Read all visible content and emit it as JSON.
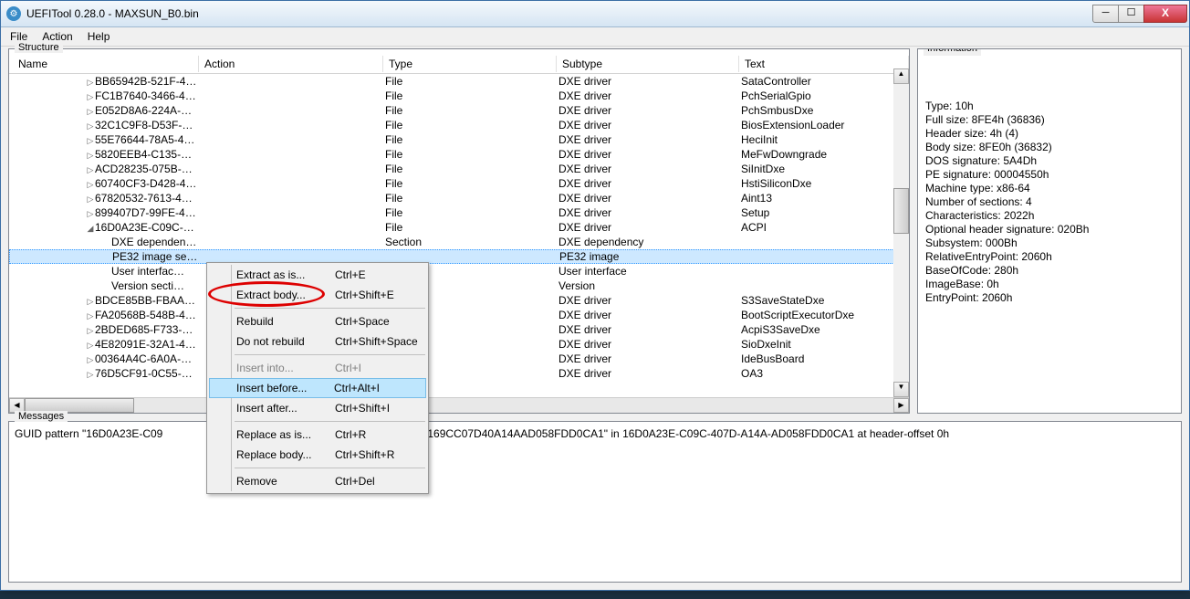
{
  "title": "UEFITool 0.28.0 - MAXSUN_B0.bin",
  "menu": {
    "file": "File",
    "action": "Action",
    "help": "Help"
  },
  "panels": {
    "structure": "Structure",
    "information": "Information",
    "messages": "Messages"
  },
  "headers": {
    "name": "Name",
    "action": "Action",
    "type": "Type",
    "subtype": "Subtype",
    "text": "Text"
  },
  "rows": [
    {
      "indent": 84,
      "tri": "▷",
      "name": "BB65942B-521F-4…",
      "type": "File",
      "subtype": "DXE driver",
      "text": "SataController"
    },
    {
      "indent": 84,
      "tri": "▷",
      "name": "FC1B7640-3466-4…",
      "type": "File",
      "subtype": "DXE driver",
      "text": "PchSerialGpio"
    },
    {
      "indent": 84,
      "tri": "▷",
      "name": "E052D8A6-224A-4…",
      "type": "File",
      "subtype": "DXE driver",
      "text": "PchSmbusDxe"
    },
    {
      "indent": 84,
      "tri": "▷",
      "name": "32C1C9F8-D53F-4…",
      "type": "File",
      "subtype": "DXE driver",
      "text": "BiosExtensionLoader"
    },
    {
      "indent": 84,
      "tri": "▷",
      "name": "55E76644-78A5-4…",
      "type": "File",
      "subtype": "DXE driver",
      "text": "HeciInit"
    },
    {
      "indent": 84,
      "tri": "▷",
      "name": "5820EEB4-C135-4…",
      "type": "File",
      "subtype": "DXE driver",
      "text": "MeFwDowngrade"
    },
    {
      "indent": 84,
      "tri": "▷",
      "name": "ACD28235-075B-4…",
      "type": "File",
      "subtype": "DXE driver",
      "text": "SiInitDxe"
    },
    {
      "indent": 84,
      "tri": "▷",
      "name": "60740CF3-D428-4…",
      "type": "File",
      "subtype": "DXE driver",
      "text": "HstiSiliconDxe"
    },
    {
      "indent": 84,
      "tri": "▷",
      "name": "67820532-7613-4…",
      "type": "File",
      "subtype": "DXE driver",
      "text": "Aint13"
    },
    {
      "indent": 84,
      "tri": "▷",
      "name": "899407D7-99FE-4…",
      "type": "File",
      "subtype": "DXE driver",
      "text": "Setup"
    },
    {
      "indent": 84,
      "tri": "◢",
      "name": "16D0A23E-C09C-4…",
      "type": "File",
      "subtype": "DXE driver",
      "text": "ACPI"
    },
    {
      "indent": 102,
      "tri": "",
      "name": "DXE dependenc…",
      "type": "Section",
      "subtype": "DXE dependency",
      "text": ""
    },
    {
      "indent": 102,
      "tri": "",
      "name": "PE32 image se…",
      "type": "",
      "subtype": "PE32 image",
      "text": "",
      "selected": true
    },
    {
      "indent": 102,
      "tri": "",
      "name": "User interfac…",
      "type": "",
      "subtype": "User interface",
      "text": ""
    },
    {
      "indent": 102,
      "tri": "",
      "name": "Version secti…",
      "type": "",
      "subtype": "Version",
      "text": ""
    },
    {
      "indent": 84,
      "tri": "▷",
      "name": "BDCE85BB-FBAA-4…",
      "type": "",
      "subtype": "DXE driver",
      "text": "S3SaveStateDxe"
    },
    {
      "indent": 84,
      "tri": "▷",
      "name": "FA20568B-548B-4…",
      "type": "",
      "subtype": "DXE driver",
      "text": "BootScriptExecutorDxe"
    },
    {
      "indent": 84,
      "tri": "▷",
      "name": "2BDED685-F733-4…",
      "type": "",
      "subtype": "DXE driver",
      "text": "AcpiS3SaveDxe"
    },
    {
      "indent": 84,
      "tri": "▷",
      "name": "4E82091E-32A1-4…",
      "type": "",
      "subtype": "DXE driver",
      "text": "SioDxeInit"
    },
    {
      "indent": 84,
      "tri": "▷",
      "name": "00364A4C-6A0A-4…",
      "type": "",
      "subtype": "DXE driver",
      "text": "IdeBusBoard"
    },
    {
      "indent": 84,
      "tri": "▷",
      "name": "76D5CF91-0C55-4…",
      "type": "",
      "subtype": "DXE driver",
      "text": "OA3"
    }
  ],
  "info_lines": [
    "Type: 10h",
    "Full size: 8FE4h (36836)",
    "Header size: 4h (4)",
    "Body size: 8FE0h (36832)",
    "DOS signature: 5A4Dh",
    "PE signature: 00004550h",
    "Machine type: x86-64",
    "Number of sections: 4",
    "Characteristics: 2022h",
    "Optional header signature: 020Bh",
    "Subsystem: 000Bh",
    "RelativeEntryPoint: 2060h",
    "BaseOfCode: 280h",
    "ImageBase: 0h",
    "EntryPoint: 2060h"
  ],
  "message_left": "GUID pattern \"16D0A23E-C09",
  "message_right": "2D0169CC07D40A14AAD058FDD0CA1\" in 16D0A23E-C09C-407D-A14A-AD058FDD0CA1 at header-offset 0h",
  "ctx": [
    {
      "label": "Extract as is...",
      "sc": "Ctrl+E"
    },
    {
      "label": "Extract body...",
      "sc": "Ctrl+Shift+E"
    },
    {
      "sep": true
    },
    {
      "label": "Rebuild",
      "sc": "Ctrl+Space"
    },
    {
      "label": "Do not rebuild",
      "sc": "Ctrl+Shift+Space"
    },
    {
      "sep": true
    },
    {
      "label": "Insert into...",
      "sc": "Ctrl+I",
      "disabled": true
    },
    {
      "label": "Insert before...",
      "sc": "Ctrl+Alt+I",
      "hover": true
    },
    {
      "label": "Insert after...",
      "sc": "Ctrl+Shift+I"
    },
    {
      "sep": true
    },
    {
      "label": "Replace as is...",
      "sc": "Ctrl+R"
    },
    {
      "label": "Replace body...",
      "sc": "Ctrl+Shift+R"
    },
    {
      "sep": true
    },
    {
      "label": "Remove",
      "sc": "Ctrl+Del"
    }
  ]
}
